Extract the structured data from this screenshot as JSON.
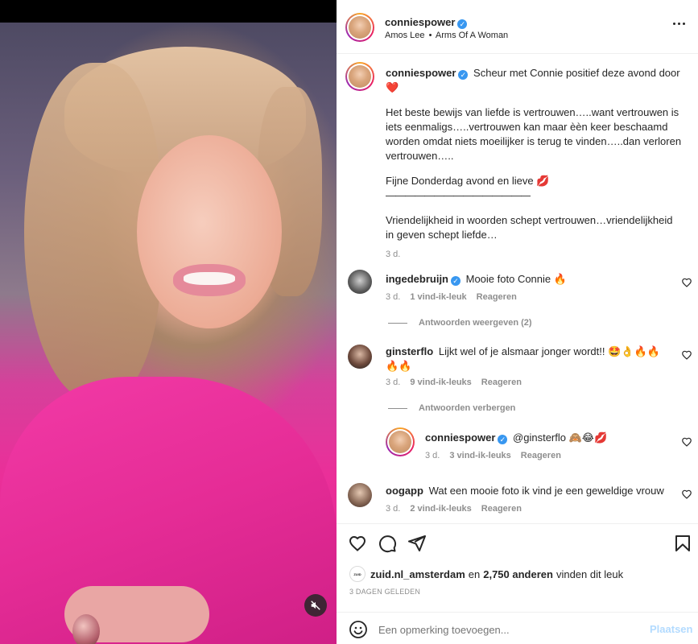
{
  "post": {
    "author": "conniespower",
    "music_artist": "Amos Lee",
    "music_separator": "•",
    "music_title": "Arms Of A Woman"
  },
  "caption": {
    "username": "conniespower",
    "line1": "Scheur met Connie positief deze avond door",
    "emoji_heart": "❤️",
    "paragraph1": "Het beste bewijs van liefde is vertrouwen…..want vertrouwen is iets eenmaligs…..vertrouwen kan maar èèn keer beschaamd worden omdat niets moeilijker is terug te vinden…..dan verloren vertrouwen…..",
    "paragraph2": "Fijne Donderdag avond en lieve 💋",
    "divider_line": "————————————————",
    "paragraph3": "Vriendelijkheid in woorden schept vertrouwen…vriendelijkheid in geven schept liefde…",
    "time": "3 d."
  },
  "comments": [
    {
      "username": "ingedebruijn",
      "verified": true,
      "text": "Mooie foto Connie 🔥",
      "time": "3 d.",
      "likes": "1 vind-ik-leuk",
      "reply": "Reageren",
      "replies_toggle": "Antwoorden weergeven (2)"
    },
    {
      "username": "ginsterflo",
      "verified": false,
      "text": "Lijkt wel of je alsmaar jonger wordt!! 🤩👌🔥🔥🔥🔥",
      "time": "3 d.",
      "likes": "9 vind-ik-leuks",
      "reply": "Reageren",
      "replies_toggle": "Antwoorden verbergen"
    },
    {
      "username": "conniespower",
      "verified": true,
      "text": "@ginsterflo 🙈😂💋",
      "time": "3 d.",
      "likes": "3 vind-ik-leuks",
      "reply": "Reageren"
    },
    {
      "username": "oogapp",
      "verified": false,
      "text": "Wat een mooie foto ik vind je een geweldige vrouw",
      "time": "3 d.",
      "likes": "2 vind-ik-leuks",
      "reply": "Reageren"
    }
  ],
  "likes": {
    "liker": "zuid.nl_amsterdam",
    "connector": "en",
    "others": "2,750 anderen",
    "suffix": "vinden dit leuk",
    "liker_avatar_text": "ZUID"
  },
  "post_date": "3 DAGEN GELEDEN",
  "comment_input": {
    "placeholder": "Een opmerking toevoegen...",
    "submit": "Plaatsen"
  },
  "icons": {
    "verified": "verified-badge-icon",
    "heart": "heart-icon",
    "comment": "comment-icon",
    "share": "share-icon",
    "bookmark": "bookmark-icon",
    "emoji": "emoji-icon",
    "mute": "mute-icon"
  },
  "colors": {
    "verified_blue": "#3897f0",
    "submit_disabled": "#b3dbff",
    "text_muted": "#8e8e8e",
    "story_ring": "#e91e63"
  }
}
